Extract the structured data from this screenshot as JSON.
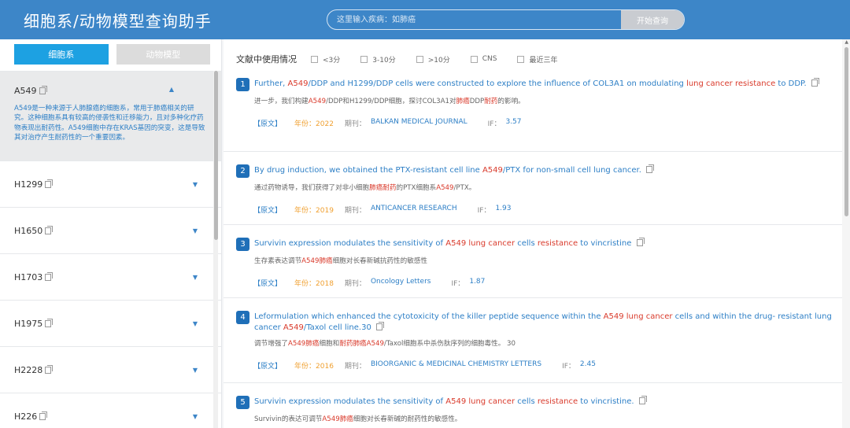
{
  "header": {
    "title": "细胞系/动物模型查询助手",
    "search_placeholder": "这里输入疾病：如肺癌",
    "search_button": "开始查询"
  },
  "tabs": [
    "细胞系",
    "动物模型"
  ],
  "cells": [
    {
      "name": "A549",
      "expanded": true,
      "desc": "A549是一种来源于人肺腺癌的细胞系，常用于肺癌相关的研究。这种细胞系具有较高的侵袭性和迁移能力，且对多种化疗药物表现出耐药性。A549细胞中存在KRAS基因的突变，这是导致其对治疗产生耐药性的一个重要因素。"
    },
    {
      "name": "H1299"
    },
    {
      "name": "H1650"
    },
    {
      "name": "H1703"
    },
    {
      "name": "H1975"
    },
    {
      "name": "H2228"
    },
    {
      "name": "H226"
    }
  ],
  "filter": {
    "label": "文献中使用情况",
    "options": [
      "<3分",
      "3-10分",
      ">10分",
      "CNS",
      "最近三年"
    ]
  },
  "articles": [
    {
      "num": "1",
      "title": "Further, <span class='hl'>A549</span>/DDP and H1299/DDP cells were constructed to explore the influence of COL3A1 on modulating <span class='hl'>lung cancer resistance</span> to DDP.",
      "cn": "进一步，我们构建<span class='hl'>A549</span>/DDP和H1299/DDP细胞，探讨COL3A1对<span class='hl'>肺癌</span>DDP<span class='hl'>耐药</span>的影响。",
      "src": "【原文】",
      "year_label": "年份：",
      "year": "2022",
      "journal_label": "期刊：",
      "journal": "BALKAN MEDICAL JOURNAL",
      "if_label": "IF：",
      "if": "3.57"
    },
    {
      "num": "2",
      "title": "By drug induction, we obtained the PTX-resistant cell line <span class='hl'>A549</span>/PTX for non-small cell lung cancer.",
      "cn": "通过药物诱导，我们获得了对非小细胞<span class='hl'>肺癌耐药</span>的PTX细胞系<span class='hl'>A549</span>/PTX。",
      "src": "【原文】",
      "year_label": "年份：",
      "year": "2019",
      "journal_label": "期刊：",
      "journal": "ANTICANCER RESEARCH",
      "if_label": "IF：",
      "if": "1.93"
    },
    {
      "num": "3",
      "title": "Survivin expression modulates the sensitivity of <span class='hl'>A549 lung cancer</span> cells <span class='hl'>resistance</span> to vincristine",
      "cn": "生存素表达调节<span class='hl'>A549肺癌</span>细胞对长春新碱抗药性的敏感性",
      "src": "【原文】",
      "year_label": "年份：",
      "year": "2018",
      "journal_label": "期刊：",
      "journal": "Oncology Letters",
      "if_label": "IF：",
      "if": "1.87"
    },
    {
      "num": "4",
      "title": "Leformulation which enhanced the cytotoxicity of the killer peptide sequence within the <span class='hl'>A549 lung cancer</span> cells and within the drug- resistant lung cancer <span class='hl'>A549</span>/Taxol cell line.30",
      "cn": "调节增强了<span class='hl'>A549肺癌</span>细胞和<span class='hl'>耐药肺癌A549</span>/Taxol细胞系中杀伤肽序列的细胞毒性。 30",
      "src": "【原文】",
      "year_label": "年份：",
      "year": "2016",
      "journal_label": "期刊：",
      "journal": "BIOORGANIC & MEDICINAL CHEMISTRY LETTERS",
      "if_label": "IF：",
      "if": "2.45"
    },
    {
      "num": "5",
      "title": "Survivin expression modulates the sensitivity of <span class='hl'>A549 lung cancer</span> cells <span class='hl'>resistance</span> to vincristine.",
      "cn": "Survivin的表达可调节<span class='hl'>A549肺癌</span>细胞对长春新碱的耐药性的敏感性。",
      "src": "【原文】",
      "year_label": "年份：",
      "year": "2018",
      "journal_label": "期刊：",
      "journal": "ONCOLOGY LETTERS",
      "if_label": "IF：",
      "if": "1.87"
    }
  ]
}
